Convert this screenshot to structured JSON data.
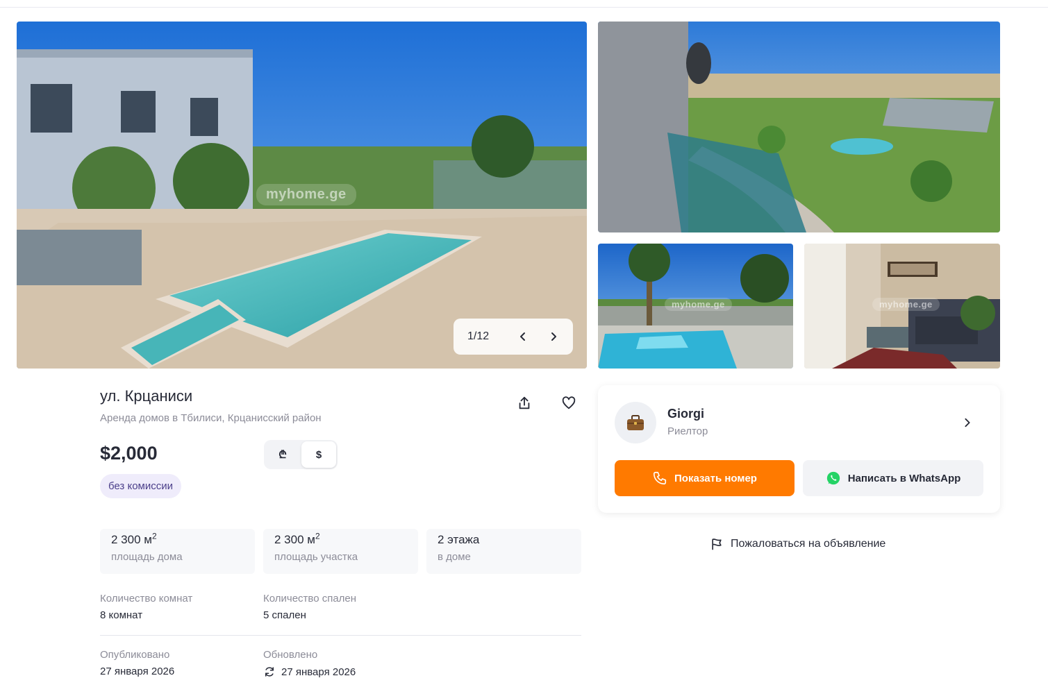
{
  "gallery": {
    "counter": "1/12",
    "watermark": "myhome.ge"
  },
  "listing": {
    "title": "ул. Крцаниси",
    "subtitle": "Аренда домов в Тбилиси, Крцанисский район",
    "price": "$2,000",
    "currency_gel": "₾",
    "currency_usd": "$",
    "active_currency": "usd",
    "badge": "без комиссии",
    "features": [
      {
        "value": "2 300 м",
        "sup": "2",
        "label": "площадь дома"
      },
      {
        "value": "2 300 м",
        "sup": "2",
        "label": "площадь участка"
      },
      {
        "value": "2 этажа",
        "sup": "",
        "label": "в доме"
      }
    ],
    "rooms_label": "Количество комнат",
    "rooms_value": "8 комнат",
    "bedrooms_label": "Количество спален",
    "bedrooms_value": "5 спален",
    "published_label": "Опубликовано",
    "published_value": "27 января 2026",
    "updated_label": "Обновлено",
    "updated_value": "27 января 2026"
  },
  "agent": {
    "name": "Giorgi",
    "role": "Риелтор",
    "show_phone_label": "Показать номер",
    "whatsapp_label": "Написать в WhatsApp"
  },
  "report_label": "Пожаловаться на объявление",
  "colors": {
    "accent": "#ff7a00",
    "whatsapp": "#25d366",
    "badge_bg": "#efecfb"
  }
}
